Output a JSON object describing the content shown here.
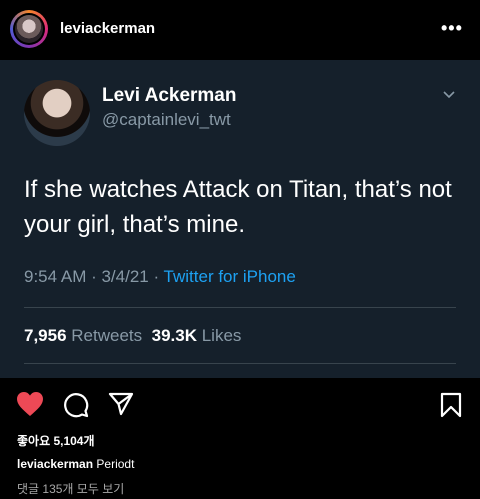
{
  "header": {
    "username": "leviackerman",
    "more_label": "•••"
  },
  "tweet": {
    "name": "Levi Ackerman",
    "handle": "@captainlevi_twt",
    "text": "If she watches Attack on Titan, that’s not your girl, that’s mine.",
    "time_date": "9:54 AM · 3/4/21 · ",
    "source": "Twitter for iPhone",
    "retweets_count": "7,956",
    "retweets_label": "Retweets",
    "likes_count": "39.3K",
    "likes_label": "Likes"
  },
  "actions": {
    "icons": [
      "heart-icon",
      "comment-icon",
      "share-icon",
      "bookmark-icon"
    ],
    "like_color": "#ed4956"
  },
  "post_info": {
    "likes_text": "좋아요 5,104개",
    "caption_user": "leviackerman",
    "caption_text": "Periodt",
    "comments_text": "댓글 135개 모두 보기"
  },
  "colors": {
    "tweet_bg": "#15202b",
    "tweet_secondary": "#8899a6",
    "tweet_link": "#1da1f2",
    "page_bg": "#000000"
  }
}
